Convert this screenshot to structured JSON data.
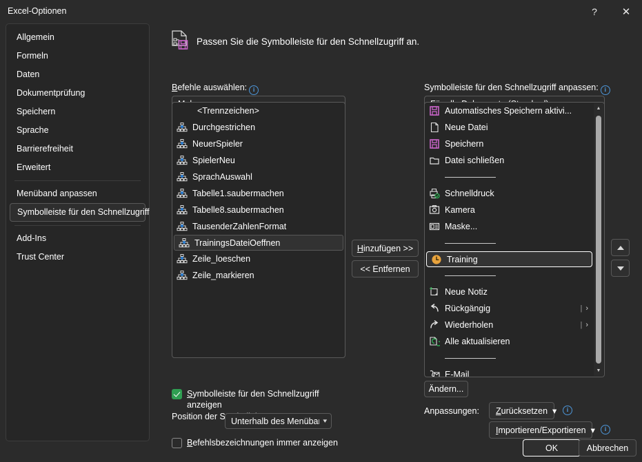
{
  "window": {
    "title": "Excel-Optionen",
    "help_label": "?",
    "close_label": "✕"
  },
  "sidebar": {
    "items": [
      {
        "label": "Allgemein",
        "selected": false
      },
      {
        "label": "Formeln",
        "selected": false
      },
      {
        "label": "Daten",
        "selected": false
      },
      {
        "label": "Dokumentprüfung",
        "selected": false
      },
      {
        "label": "Speichern",
        "selected": false
      },
      {
        "label": "Sprache",
        "selected": false
      },
      {
        "label": "Barrierefreiheit",
        "selected": false
      },
      {
        "label": "Erweitert",
        "selected": false
      },
      {
        "label": "Menüband anpassen",
        "selected": false
      },
      {
        "label": "Symbolleiste für den Schnellzugriff",
        "selected": true
      },
      {
        "label": "Add-Ins",
        "selected": false
      },
      {
        "label": "Trust Center",
        "selected": false
      }
    ]
  },
  "header": {
    "icon": "customize-quick-access-icon",
    "title": "Passen Sie die Symbolleiste für den Schnellzugriff an."
  },
  "left_panel": {
    "label": "Befehle auswählen:",
    "info_icon": "info-icon",
    "combo_value": "Makros",
    "items": [
      {
        "label": "<Trennzeichen>",
        "icon": "none",
        "selected": false
      },
      {
        "label": "Durchgestrichen",
        "icon": "macro-icon",
        "selected": false
      },
      {
        "label": "NeuerSpieler",
        "icon": "macro-icon",
        "selected": false
      },
      {
        "label": "SpielerNeu",
        "icon": "macro-icon",
        "selected": false
      },
      {
        "label": "SprachAuswahl",
        "icon": "macro-icon",
        "selected": false
      },
      {
        "label": "Tabelle1.saubermachen",
        "icon": "macro-icon",
        "selected": false
      },
      {
        "label": "Tabelle8.saubermachen",
        "icon": "macro-icon",
        "selected": false
      },
      {
        "label": "TausenderZahlenFormat",
        "icon": "macro-icon",
        "selected": false
      },
      {
        "label": "TrainingsDateiOeffnen",
        "icon": "macro-icon",
        "selected": true
      },
      {
        "label": "Zeile_loeschen",
        "icon": "macro-icon",
        "selected": false
      },
      {
        "label": "Zeile_markieren",
        "icon": "macro-icon",
        "selected": false
      }
    ]
  },
  "middle_buttons": {
    "add_label": "Hinzufügen >>",
    "remove_label": "<< Entfernen"
  },
  "right_panel": {
    "label": "Symbolleiste für den Schnellzugriff anpassen:",
    "info_icon": "info-icon",
    "combo_value": "Für alle Dokumente (Standard)",
    "items": [
      {
        "label": "Automatisches Speichern aktivi...",
        "icon": "save-magenta-icon",
        "selected": false,
        "submenu": false
      },
      {
        "label": "Neue Datei",
        "icon": "new-file-icon",
        "selected": false,
        "submenu": false
      },
      {
        "label": "Speichern",
        "icon": "save-magenta-icon",
        "selected": false,
        "submenu": false
      },
      {
        "label": "Datei schließen",
        "icon": "folder-icon",
        "selected": false,
        "submenu": false
      },
      {
        "label": "",
        "icon": "separator",
        "selected": false,
        "submenu": false
      },
      {
        "label": "Schnelldruck",
        "icon": "quick-print-icon",
        "selected": false,
        "submenu": false
      },
      {
        "label": "Kamera",
        "icon": "camera-icon",
        "selected": false,
        "submenu": false
      },
      {
        "label": "Maske...",
        "icon": "form-icon",
        "selected": false,
        "submenu": false
      },
      {
        "label": "",
        "icon": "separator",
        "selected": false,
        "submenu": false
      },
      {
        "label": "Training",
        "icon": "clock-orange-icon",
        "selected": true,
        "submenu": false
      },
      {
        "label": "",
        "icon": "separator",
        "selected": false,
        "submenu": false
      },
      {
        "label": "Neue Notiz",
        "icon": "new-note-icon",
        "selected": false,
        "submenu": false
      },
      {
        "label": "Rückgängig",
        "icon": "undo-icon",
        "selected": false,
        "submenu": true
      },
      {
        "label": "Wiederholen",
        "icon": "redo-icon",
        "selected": false,
        "submenu": true
      },
      {
        "label": "Alle aktualisieren",
        "icon": "refresh-all-icon",
        "selected": false,
        "submenu": false
      },
      {
        "label": "",
        "icon": "separator",
        "selected": false,
        "submenu": false
      },
      {
        "label": "E-Mail",
        "icon": "email-icon",
        "selected": false,
        "submenu": false
      }
    ],
    "submenu_caret": "›",
    "scroll_up": "▲",
    "scroll_down": "▼"
  },
  "reorder_buttons": {
    "up_label": "Nach oben",
    "down_label": "Nach unten"
  },
  "bottom_left": {
    "show_toolbar_checkbox": {
      "label": "Symbolleiste für den Schnellzugriff anzeigen",
      "checked": true
    },
    "position_label": "Position der Symbolleiste",
    "position_value": "Unterhalb des Menübandes",
    "show_labels_checkbox": {
      "label": "Befehlsbezeichnungen immer anzeigen",
      "checked": false
    }
  },
  "bottom_right": {
    "modify_label": "Ändern...",
    "customizations_label": "Anpassungen:",
    "reset_label": "Zurücksetzen",
    "import_export_label": "Importieren/Exportieren",
    "caret": "⌄"
  },
  "footer": {
    "ok_label": "OK",
    "cancel_label": "Abbrechen"
  },
  "colors": {
    "background": "#2b2b2b",
    "panel": "#262626",
    "border": "#5a5a5a",
    "accent_magenta": "#c864c8",
    "accent_orange": "#e8a33d",
    "accent_green": "#2f9e52",
    "accent_blue": "#4d96d9",
    "text": "#ffffff"
  }
}
